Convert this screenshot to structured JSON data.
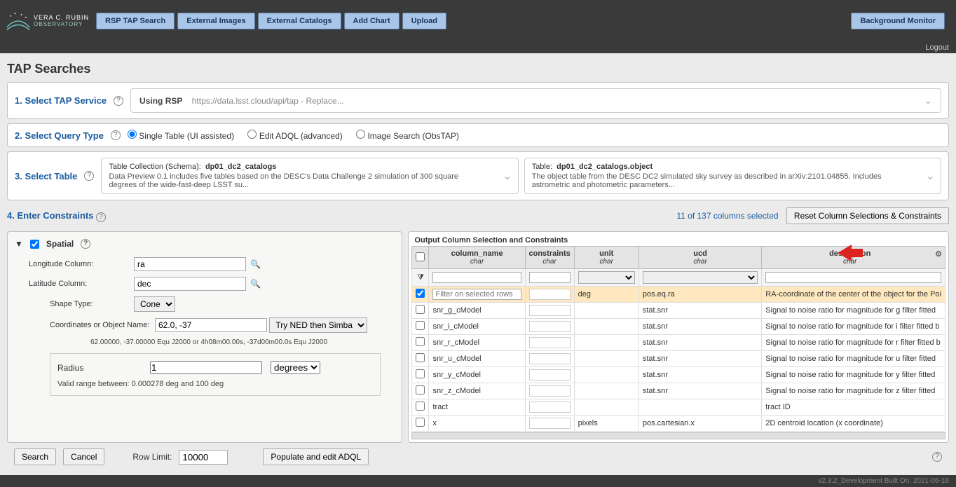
{
  "logo": {
    "line1": "VERA C. RUBIN",
    "line2": "OBSERVATORY"
  },
  "tabs": {
    "rsp": "RSP TAP Search",
    "ext_img": "External Images",
    "ext_cat": "External Catalogs",
    "add_chart": "Add Chart",
    "upload": "Upload",
    "bg_monitor": "Background Monitor"
  },
  "logout": "Logout",
  "page_title": "TAP Searches",
  "step1": {
    "label": "1. Select TAP Service",
    "using": "Using RSP",
    "url": "https://data.lsst.cloud/api/tap - Replace..."
  },
  "step2": {
    "label": "2. Select Query Type",
    "opt1": "Single Table (UI assisted)",
    "opt2": "Edit ADQL (advanced)",
    "opt3": "Image Search (ObsTAP)"
  },
  "step3": {
    "label": "3. Select Table",
    "card1": {
      "hdr_lbl": "Table Collection (Schema):",
      "hdr_val": "dp01_dc2_catalogs",
      "desc": "Data Preview 0.1 includes five tables based on the DESC's Data Challenge 2 simulation of 300 square degrees of the wide-fast-deep LSST su..."
    },
    "card2": {
      "hdr_lbl": "Table:",
      "hdr_val": "dp01_dc2_catalogs.object",
      "desc": "The object table from the DESC DC2 simulated sky survey as described in arXiv:2101.04855. Includes astrometric and photometric parameters..."
    }
  },
  "step4": {
    "label": "4. Enter Constraints",
    "sel_count": "11 of 137 columns selected",
    "reset": "Reset Column Selections & Constraints"
  },
  "spatial": {
    "title": "Spatial",
    "lon_lbl": "Longitude Column:",
    "lon_val": "ra",
    "lat_lbl": "Latitude Column:",
    "lat_val": "dec",
    "shape_lbl": "Shape Type:",
    "shape_val": "Cone",
    "coord_lbl": "Coordinates or Object Name:",
    "coord_val": "62.0, -37",
    "resolver": "Try NED then Simbad",
    "hint": "62.00000, -37.00000  Equ J2000    or    4h08m00.00s, -37d00m00.0s  Equ J2000",
    "radius_lbl": "Radius",
    "radius_val": "1",
    "radius_unit": "degrees",
    "radius_hint": "Valid range between: 0.000278 deg and 100 deg"
  },
  "output": {
    "title": "Output Column Selection and Constraints",
    "headers": {
      "name": "column_name",
      "con": "constraints",
      "unit": "unit",
      "ucd": "ucd",
      "desc": "description",
      "sub": "char"
    },
    "filter_placeholder": "Filter on selected rows",
    "rows": [
      {
        "sel": true,
        "name": "",
        "con": "",
        "unit": "deg",
        "ucd": "pos.eq.ra",
        "desc": "RA-coordinate of the center of the object for the Poi"
      },
      {
        "sel": false,
        "name": "snr_g_cModel",
        "con": "",
        "unit": "",
        "ucd": "stat.snr",
        "desc": "Signal to noise ratio for magnitude for g filter fitted"
      },
      {
        "sel": false,
        "name": "snr_i_cModel",
        "con": "",
        "unit": "",
        "ucd": "stat.snr",
        "desc": "Signal to noise ratio for magnitude for i filter fitted b"
      },
      {
        "sel": false,
        "name": "snr_r_cModel",
        "con": "",
        "unit": "",
        "ucd": "stat.snr",
        "desc": "Signal to noise ratio for magnitude for r filter fitted b"
      },
      {
        "sel": false,
        "name": "snr_u_cModel",
        "con": "",
        "unit": "",
        "ucd": "stat.snr",
        "desc": "Signal to noise ratio for magnitude for u filter fitted"
      },
      {
        "sel": false,
        "name": "snr_y_cModel",
        "con": "",
        "unit": "",
        "ucd": "stat.snr",
        "desc": "Signal to noise ratio for magnitude for y filter fitted"
      },
      {
        "sel": false,
        "name": "snr_z_cModel",
        "con": "",
        "unit": "",
        "ucd": "stat.snr",
        "desc": "Signal to noise ratio for magnitude for z filter fitted"
      },
      {
        "sel": false,
        "name": "tract",
        "con": "",
        "unit": "",
        "ucd": "",
        "desc": "tract ID"
      },
      {
        "sel": false,
        "name": "x",
        "con": "",
        "unit": "pixels",
        "ucd": "pos.cartesian.x",
        "desc": "2D centroid location (x coordinate)"
      }
    ]
  },
  "bottom": {
    "search": "Search",
    "cancel": "Cancel",
    "rowlimit_lbl": "Row Limit:",
    "rowlimit_val": "10000",
    "populate": "Populate and edit ADQL"
  },
  "footer": "v2.3.2_Development Built On: 2021-06-16"
}
